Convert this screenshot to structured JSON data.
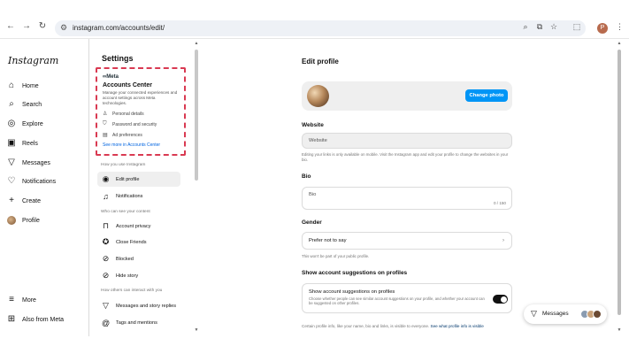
{
  "browser": {
    "url": "instagram.com/accounts/edit/",
    "profile_initial": "P"
  },
  "leftnav": {
    "logo": "Instagram",
    "items": [
      {
        "label": "Home",
        "icon": "home-icon",
        "glyph": "⌂"
      },
      {
        "label": "Search",
        "icon": "search-icon",
        "glyph": "⌕"
      },
      {
        "label": "Explore",
        "icon": "compass-icon",
        "glyph": "◎"
      },
      {
        "label": "Reels",
        "icon": "reels-icon",
        "glyph": "▣"
      },
      {
        "label": "Messages",
        "icon": "messenger-icon",
        "glyph": "▽"
      },
      {
        "label": "Notifications",
        "icon": "heart-icon",
        "glyph": "♡"
      },
      {
        "label": "Create",
        "icon": "plus-icon",
        "glyph": "+"
      },
      {
        "label": "Profile",
        "icon": "profile-avatar-icon",
        "glyph": ""
      }
    ],
    "bottom_items": [
      {
        "label": "More",
        "icon": "menu-icon",
        "glyph": "≡"
      },
      {
        "label": "Also from Meta",
        "icon": "threads-icon",
        "glyph": "⊞"
      }
    ]
  },
  "settings": {
    "title": "Settings",
    "accounts_center": {
      "meta": "∞Meta",
      "title": "Accounts Center",
      "desc": "Manage your connected experiences and account settings across Meta technologies.",
      "rows": [
        {
          "label": "Personal details",
          "icon": "person-icon",
          "glyph": "♙"
        },
        {
          "label": "Password and security",
          "icon": "shield-icon",
          "glyph": "⛉"
        },
        {
          "label": "Ad preferences",
          "icon": "ad-icon",
          "glyph": "▤"
        }
      ],
      "link": "See more in Accounts Center"
    },
    "section_use": "How you use Instagram",
    "section_see": "Who can see your content",
    "section_interact": "How others can interact with you",
    "items_use": [
      {
        "label": "Edit profile",
        "glyph": "◉",
        "icon": "edit-profile-icon"
      },
      {
        "label": "Notifications",
        "glyph": "🔔︎",
        "icon": "bell-icon"
      }
    ],
    "items_see": [
      {
        "label": "Account privacy",
        "glyph": "🔒︎",
        "icon": "lock-icon"
      },
      {
        "label": "Close Friends",
        "glyph": "✪",
        "icon": "close-friends-icon"
      },
      {
        "label": "Blocked",
        "glyph": "⊘",
        "icon": "blocked-icon"
      },
      {
        "label": "Hide story",
        "glyph": "⊘",
        "icon": "hide-story-icon"
      }
    ],
    "items_interact": [
      {
        "label": "Messages and story replies",
        "glyph": "▽",
        "icon": "messages-icon"
      },
      {
        "label": "Tags and mentions",
        "glyph": "@",
        "icon": "at-icon"
      }
    ]
  },
  "main": {
    "title": "Edit profile",
    "change_photo": "Change photo",
    "website_label": "Website",
    "website_placeholder": "Website",
    "website_help": "Editing your links is only available on mobile. Visit the Instagram app and edit your profile to change the websites in your bio.",
    "bio_label": "Bio",
    "bio_placeholder": "Bio",
    "bio_counter": "0 / 150",
    "gender_label": "Gender",
    "gender_value": "Prefer not to say",
    "gender_help": "This won't be part of your public profile.",
    "suggestions_heading": "Show account suggestions on profiles",
    "suggestions_title": "Show account suggestions on profiles",
    "suggestions_desc": "Choose whether people can see similar account suggestions on your profile, and whether your account can be suggested on other profiles.",
    "suggestions_on": true,
    "bottom_note": "Certain profile info, like your name, bio and links, is visible to everyone.",
    "bottom_link": "See what profile info is visible"
  },
  "messages_pill": {
    "label": "Messages"
  },
  "colors": {
    "accent": "#0095f6",
    "highlight_box": "#d93a52",
    "link": "#0064e0"
  }
}
